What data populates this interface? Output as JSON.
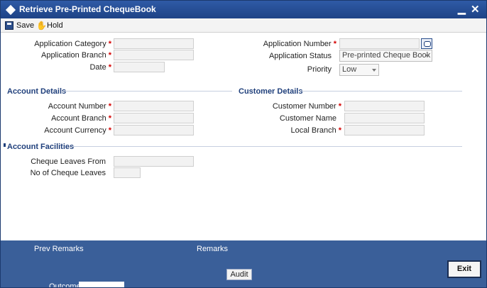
{
  "window": {
    "title": "Retrieve Pre-Printed ChequeBook",
    "minimize_label": "▁",
    "close_label": "✕"
  },
  "toolbar": {
    "save_label": "Save",
    "hold_label": "Hold"
  },
  "application": {
    "category_label": "Application Category",
    "branch_label": "Application Branch",
    "date_label": "Date",
    "number_label": "Application Number",
    "status_label": "Application Status",
    "status_value": "Pre-printed Cheque Book",
    "priority_label": "Priority",
    "priority_value": "Low",
    "required_marker": "*"
  },
  "account_details": {
    "section_title": "Account Details",
    "number_label": "Account Number",
    "branch_label": "Account Branch",
    "currency_label": "Account Currency"
  },
  "customer_details": {
    "section_title": "Customer Details",
    "number_label": "Customer Number",
    "name_label": "Customer Name",
    "local_branch_label": "Local Branch"
  },
  "account_facilities": {
    "section_title": "Account Facilities",
    "cheque_from_label": "Cheque Leaves From",
    "no_cheque_label": "No of Cheque Leaves"
  },
  "footer": {
    "prev_remarks_label": "Prev Remarks",
    "remarks_label": "Remarks",
    "audit_label": "Audit",
    "exit_label": "Exit",
    "outcome_label": "Outcome"
  }
}
